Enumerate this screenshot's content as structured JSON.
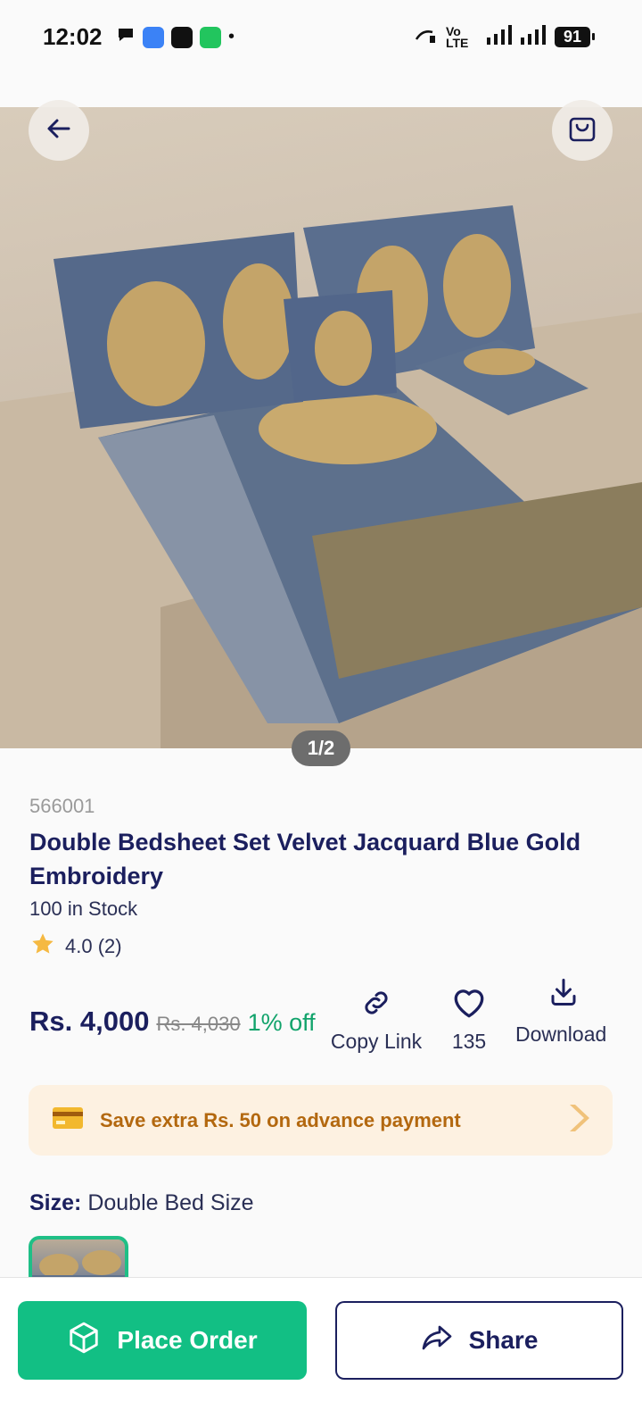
{
  "status_bar": {
    "time": "12:02",
    "battery": "91",
    "network": "Vo LTE"
  },
  "hero": {
    "pager": "1/2"
  },
  "product": {
    "sku": "566001",
    "title": "Double Bedsheet Set Velvet Jacquard Blue Gold Embroidery",
    "stock": "100 in Stock",
    "rating": "4.0 (2)",
    "price": "Rs. 4,000",
    "mrp": "Rs. 4,030",
    "discount": "1% off"
  },
  "actions": {
    "copy_link": "Copy Link",
    "wishlist_count": "135",
    "download": "Download"
  },
  "promo": {
    "text": "Save extra Rs. 50 on advance payment"
  },
  "size": {
    "label": "Size:",
    "value": "Double Bed Size"
  },
  "bottom": {
    "place_order": "Place Order",
    "share": "Share"
  },
  "colors": {
    "primary": "#12bf84",
    "navy": "#1b1f5e",
    "promo_bg": "#fdf1e1",
    "promo_text": "#b3680f"
  }
}
